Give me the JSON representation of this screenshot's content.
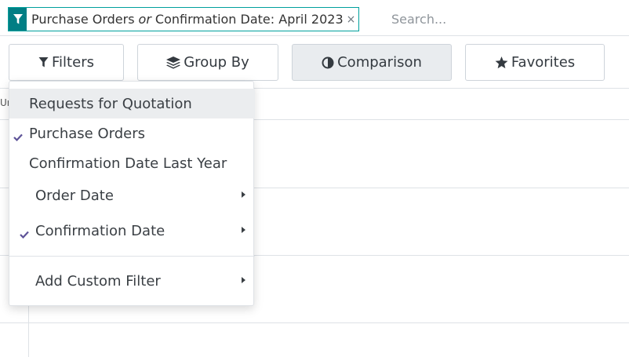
{
  "search": {
    "facet": {
      "value_a": "Purchase Orders",
      "separator": "or",
      "value_b": "Confirmation Date: April 2023",
      "remove": "×"
    },
    "placeholder": "Search..."
  },
  "toolbar": {
    "filters_label": "Filters",
    "groupby_label": "Group By",
    "comparison_label": "Comparison",
    "favorites_label": "Favorites"
  },
  "background": {
    "clipped_text": "Ur"
  },
  "filters_menu": {
    "items": [
      {
        "label": "Requests for Quotation",
        "checked": false,
        "hovered": true
      },
      {
        "label": "Purchase Orders",
        "checked": true
      },
      {
        "label": "Confirmation Date Last Year",
        "checked": false
      },
      {
        "label": "Order Date",
        "checked": false,
        "has_submenu": true
      },
      {
        "label": "Confirmation Date",
        "checked": true,
        "has_submenu": true
      },
      {
        "label": "Add Custom Filter",
        "checked": false,
        "has_submenu": true
      }
    ]
  },
  "colors": {
    "facet_accent": "#017e84",
    "check": "#5e5398",
    "hover_bg": "#ebedef"
  }
}
